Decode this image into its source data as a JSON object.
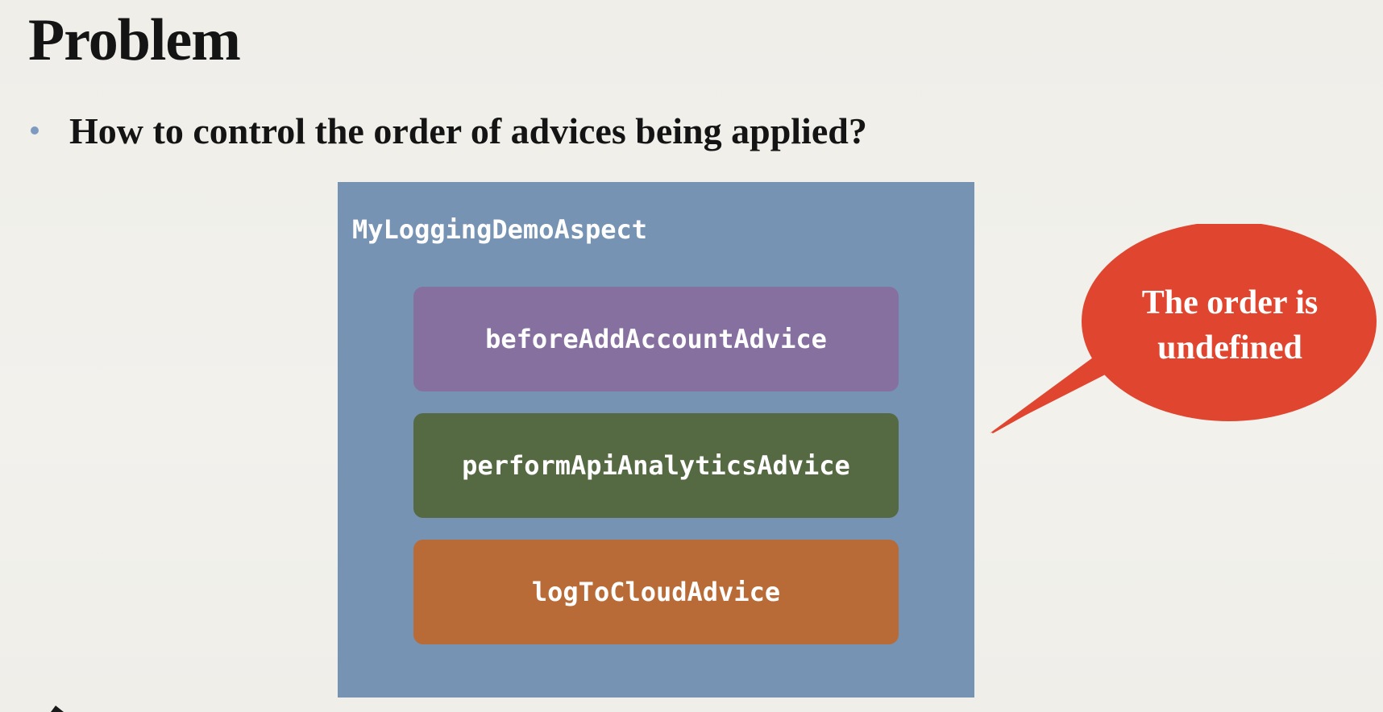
{
  "slide": {
    "title": "Problem",
    "bullet": "How to control the order of advices being applied?"
  },
  "diagram": {
    "aspect_name": "MyLoggingDemoAspect",
    "advices": [
      {
        "label": "beforeAddAccountAdvice",
        "color": "#8570a0"
      },
      {
        "label": "performApiAnalyticsAdvice",
        "color": "#556a42"
      },
      {
        "label": "logToCloudAdvice",
        "color": "#b86b36"
      }
    ],
    "aspect_color": "#7693b3"
  },
  "callout": {
    "line1": "The order is",
    "line2": "undefined",
    "color": "#e0462f"
  },
  "colors": {
    "bullet_dot": "#7e9bbf",
    "background": "#f0efea"
  }
}
